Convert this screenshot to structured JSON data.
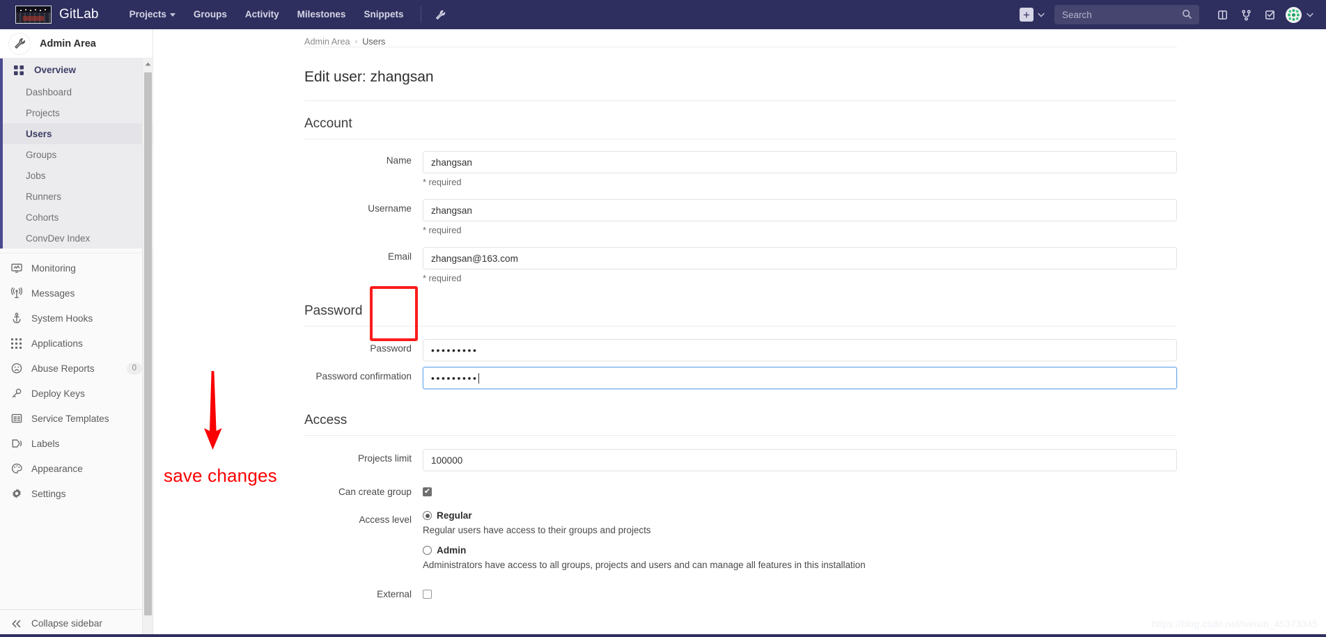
{
  "topnav": {
    "brand": "GitLab",
    "logo_icon": "team-photo-logo",
    "links": [
      {
        "label": "Projects",
        "has_caret": true
      },
      {
        "label": "Groups",
        "has_caret": false
      },
      {
        "label": "Activity",
        "has_caret": false
      },
      {
        "label": "Milestones",
        "has_caret": false
      },
      {
        "label": "Snippets",
        "has_caret": false
      }
    ],
    "admin_wrench_icon": "wrench-icon",
    "new_button_icon": "plus-icon",
    "search": {
      "placeholder": "Search",
      "value": "",
      "icon": "search-icon"
    },
    "right_icons": [
      {
        "name": "issues-icon"
      },
      {
        "name": "merge-requests-icon"
      },
      {
        "name": "todos-icon"
      }
    ],
    "avatar_icon": "user-avatar",
    "bg_color": "#2e2e5f"
  },
  "sidebar": {
    "title": "Admin Area",
    "title_icon": "wrench-icon",
    "overview": {
      "label": "Overview",
      "icon": "grid-icon"
    },
    "overview_children": [
      {
        "label": "Dashboard",
        "active": false
      },
      {
        "label": "Projects",
        "active": false
      },
      {
        "label": "Users",
        "active": true
      },
      {
        "label": "Groups",
        "active": false
      },
      {
        "label": "Jobs",
        "active": false
      },
      {
        "label": "Runners",
        "active": false
      },
      {
        "label": "Cohorts",
        "active": false
      },
      {
        "label": "ConvDev Index",
        "active": false
      }
    ],
    "items": [
      {
        "label": "Monitoring",
        "icon": "monitor-icon",
        "badge": null
      },
      {
        "label": "Messages",
        "icon": "broadcast-icon",
        "badge": null
      },
      {
        "label": "System Hooks",
        "icon": "hook-icon",
        "badge": null
      },
      {
        "label": "Applications",
        "icon": "apps-grid-icon",
        "badge": null
      },
      {
        "label": "Abuse Reports",
        "icon": "abuse-face-icon",
        "badge": "0"
      },
      {
        "label": "Deploy Keys",
        "icon": "key-icon",
        "badge": null
      },
      {
        "label": "Service Templates",
        "icon": "template-icon",
        "badge": null
      },
      {
        "label": "Labels",
        "icon": "label-tag-icon",
        "badge": null
      },
      {
        "label": "Appearance",
        "icon": "palette-icon",
        "badge": null
      },
      {
        "label": "Settings",
        "icon": "gear-icon",
        "badge": null
      }
    ],
    "collapse": {
      "label": "Collapse sidebar",
      "icon": "double-chevron-left-icon"
    }
  },
  "breadcrumb": {
    "root": "Admin Area",
    "separator": "›",
    "current": "Users"
  },
  "page": {
    "title": "Edit user: zhangsan"
  },
  "sections": {
    "account": {
      "heading": "Account",
      "fields": [
        {
          "label": "Name",
          "value": "zhangsan",
          "help": "* required",
          "type": "text"
        },
        {
          "label": "Username",
          "value": "zhangsan",
          "help": "* required",
          "type": "text"
        },
        {
          "label": "Email",
          "value": "zhangsan@163.com",
          "help": "* required",
          "type": "text"
        }
      ]
    },
    "password": {
      "heading": "Password",
      "fields": [
        {
          "label": "Password",
          "value": "•••••••••",
          "type": "password",
          "focused": false
        },
        {
          "label": "Password confirmation",
          "value": "•••••••••",
          "type": "password",
          "focused": true
        }
      ]
    },
    "access": {
      "heading": "Access",
      "projects_limit": {
        "label": "Projects limit",
        "value": "100000"
      },
      "can_create_group": {
        "label": "Can create group",
        "checked": true
      },
      "access_level": {
        "label": "Access level",
        "options": [
          {
            "label": "Regular",
            "description": "Regular users have access to their groups and projects",
            "selected": true
          },
          {
            "label": "Admin",
            "description": "Administrators have access to all groups, projects and users and can manage all features in this installation",
            "selected": false
          }
        ]
      },
      "external": {
        "label": "External",
        "checked": false
      }
    }
  },
  "annotations": {
    "arrow_color": "#fb0000",
    "box_color": "#fb1c1c",
    "save_changes_text": "save changes",
    "password_highlight": "password-fields-highlight"
  },
  "watermark": "https://blog.csdn.net/weixin_45373345"
}
